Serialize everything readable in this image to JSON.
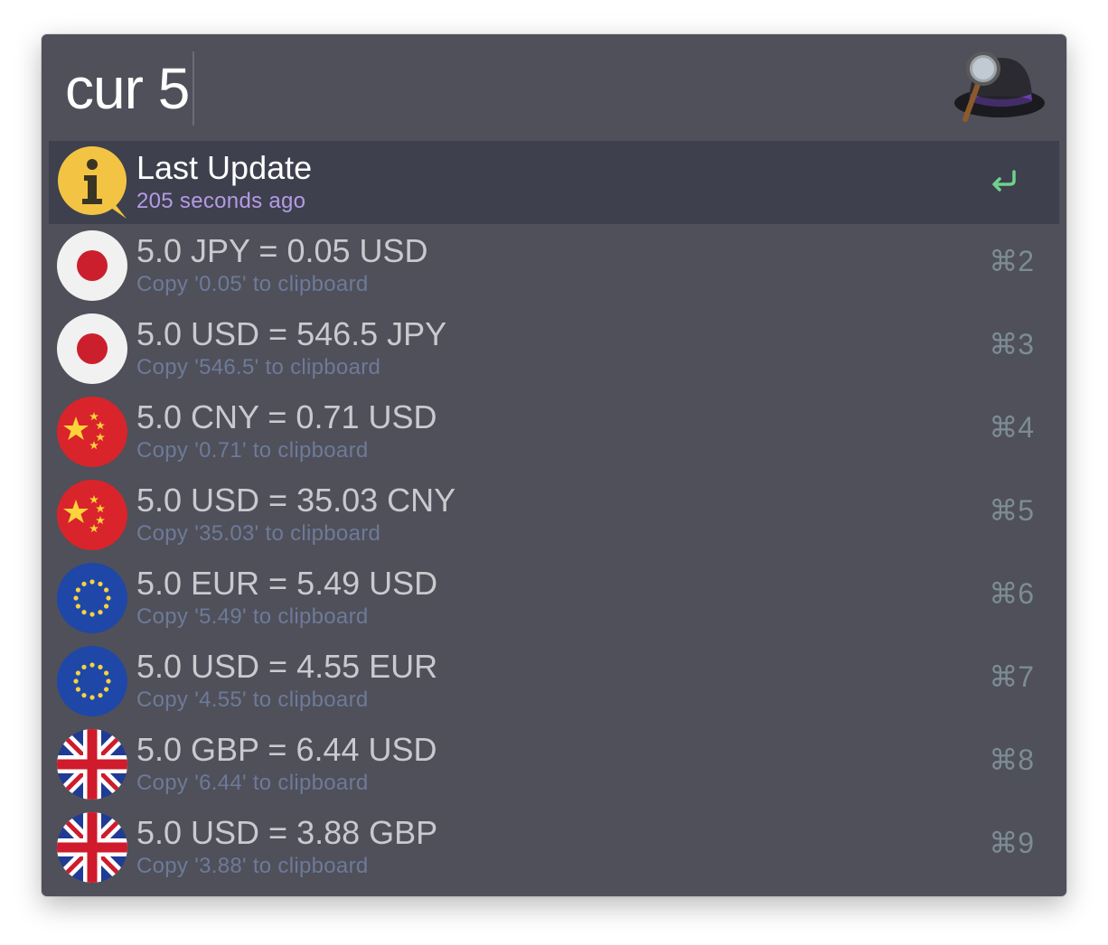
{
  "search": {
    "query": "cur 5"
  },
  "app": {
    "logo_icon": "alfred-hat-icon"
  },
  "colors": {
    "window_bg": "#4f5059",
    "selected_row_bg": "#3e404d",
    "selected_subtitle": "#b59ae5",
    "subtitle": "#6e7a9a",
    "return_icon": "#6fd18c"
  },
  "results": [
    {
      "icon": "info-icon",
      "title": "Last Update",
      "subtitle": "205 seconds ago",
      "selected": true,
      "shortcut_icon": "return-icon"
    },
    {
      "icon": "japan-flag-icon",
      "title": "5.0 JPY = 0.05 USD",
      "subtitle": "Copy '0.05' to clipboard",
      "shortcut": "⌘2"
    },
    {
      "icon": "japan-flag-icon",
      "title": "5.0 USD = 546.5 JPY",
      "subtitle": "Copy '546.5' to clipboard",
      "shortcut": "⌘3"
    },
    {
      "icon": "china-flag-icon",
      "title": "5.0 CNY = 0.71 USD",
      "subtitle": "Copy '0.71' to clipboard",
      "shortcut": "⌘4"
    },
    {
      "icon": "china-flag-icon",
      "title": "5.0 USD = 35.03 CNY",
      "subtitle": "Copy '35.03' to clipboard",
      "shortcut": "⌘5"
    },
    {
      "icon": "eu-flag-icon",
      "title": "5.0 EUR = 5.49 USD",
      "subtitle": "Copy '5.49' to clipboard",
      "shortcut": "⌘6"
    },
    {
      "icon": "eu-flag-icon",
      "title": "5.0 USD = 4.55 EUR",
      "subtitle": "Copy '4.55' to clipboard",
      "shortcut": "⌘7"
    },
    {
      "icon": "uk-flag-icon",
      "title": "5.0 GBP = 6.44 USD",
      "subtitle": "Copy '6.44' to clipboard",
      "shortcut": "⌘8"
    },
    {
      "icon": "uk-flag-icon",
      "title": "5.0 USD = 3.88 GBP",
      "subtitle": "Copy '3.88' to clipboard",
      "shortcut": "⌘9"
    }
  ]
}
